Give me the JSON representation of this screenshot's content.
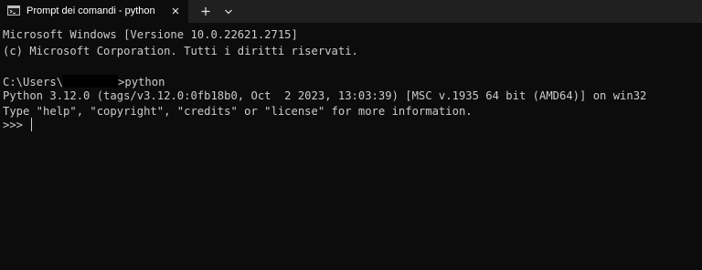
{
  "tab": {
    "title": "Prompt dei comandi - python",
    "icon": "command-prompt-icon",
    "close_icon": "close-icon"
  },
  "toolbar": {
    "new_tab_icon": "plus-icon",
    "dropdown_icon": "chevron-down-icon"
  },
  "terminal": {
    "line1": "Microsoft Windows [Versione 10.0.22621.2715]",
    "line2": "(c) Microsoft Corporation. Tutti i diritti riservati.",
    "prompt_prefix": "C:\\Users\\",
    "prompt_suffix": ">python",
    "python_version_line": "Python 3.12.0 (tags/v3.12.0:0fb18b0, Oct  2 2023, 13:03:39) [MSC v.1935 64 bit (AMD64)] on win32",
    "help_line": "Type \"help\", \"copyright\", \"credits\" or \"license\" for more information.",
    "repl_prompt": ">>> "
  },
  "colors": {
    "terminal_bg": "#0c0c0c",
    "tabbar_bg": "#202020",
    "text": "#cccccc"
  }
}
